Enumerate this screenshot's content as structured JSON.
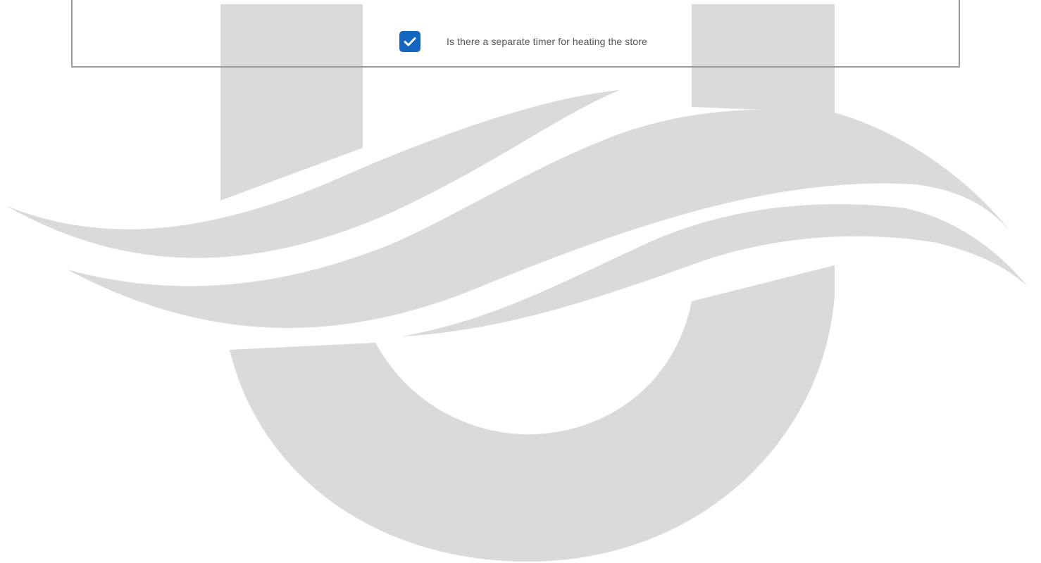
{
  "form": {
    "checkbox": {
      "checked": true,
      "label": "Is there a separate timer for heating the store",
      "icon": "check-icon",
      "color": "#1466c0"
    }
  },
  "watermark": {
    "icon": "logo-watermark",
    "color": "#dadada"
  }
}
